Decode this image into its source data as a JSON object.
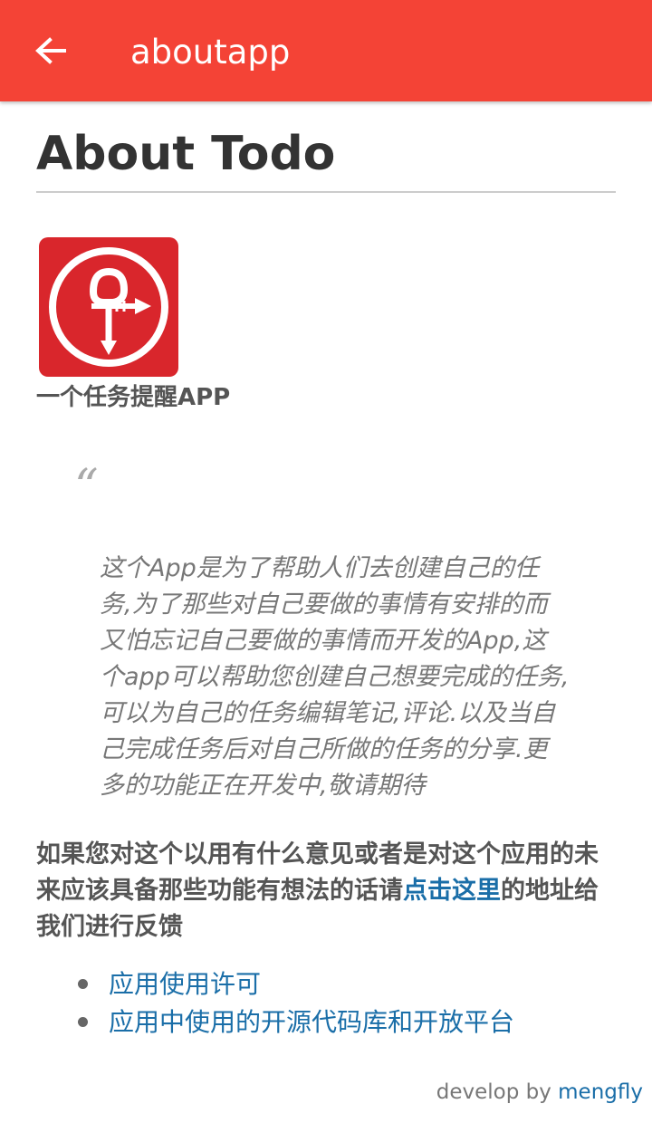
{
  "appbar": {
    "title": "aboutapp",
    "color": "#f44336"
  },
  "page": {
    "title": "About Todo",
    "tagline": "一个任务提醒APP",
    "quote_mark": "“",
    "quote_text": "这个App是为了帮助人们去创建自己的任务,为了那些对自己要做的事情有安排的而又怕忘记自己要做的事情而开发的App,这个app可以帮助您创建自己想要完成的任务,可以为自己的任务编辑笔记,评论.以及当自己完成任务后对自己所做的任务的分享.更多的功能正在开发中,敬请期待",
    "feedback_before": "如果您对这个以用有什么意见或者是对这个应用的未来应该具备那些功能有想法的话请",
    "feedback_link": "点击这里",
    "feedback_after": "的地址给我们进行反馈"
  },
  "links": [
    {
      "label": "应用使用许可"
    },
    {
      "label": "应用中使用的开源代码库和开放平台"
    }
  ],
  "footer": {
    "prefix": "develop by ",
    "author": "mengfly"
  },
  "colors": {
    "accent": "#f44336",
    "link": "#1a6ea8",
    "logo_bg": "#d9262c"
  },
  "icons": {
    "back": "arrow-left-icon",
    "logo": "todo-app-logo"
  }
}
